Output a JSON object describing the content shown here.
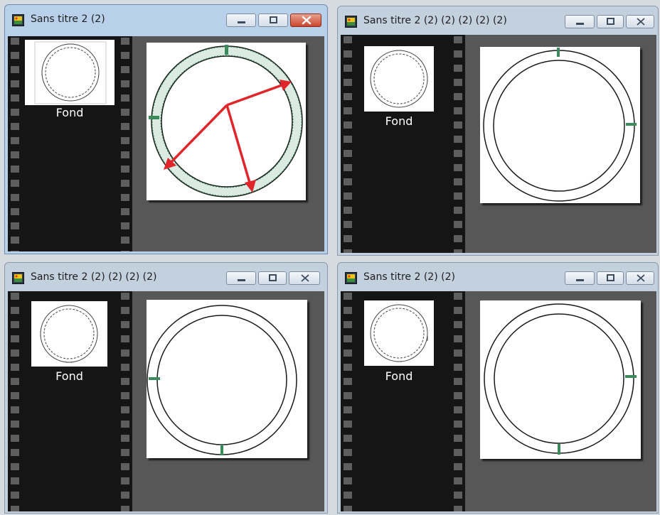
{
  "colors": {
    "titlebar_active": "#b9d0ea",
    "titlebar_inactive": "#c3d0de",
    "workspace": "#575757",
    "film_strip": "#151515",
    "marker": "#3a8a5c",
    "arrow": "#e0262b"
  },
  "windows": [
    {
      "title": "Sans titre 2 (2)",
      "active": true,
      "layer_label": "Fond",
      "icons": [
        "image-icon",
        "minimize-icon",
        "maximize-icon",
        "close-icon"
      ]
    },
    {
      "title": "Sans titre 2 (2) (2) (2) (2) (2)",
      "active": false,
      "layer_label": "Fond",
      "icons": [
        "image-icon",
        "minimize-icon",
        "maximize-icon",
        "close-icon"
      ]
    },
    {
      "title": "Sans titre 2 (2) (2) (2) (2)",
      "active": false,
      "layer_label": "Fond",
      "icons": [
        "image-icon",
        "minimize-icon",
        "maximize-icon",
        "close-icon"
      ]
    },
    {
      "title": "Sans titre 2 (2) (2)",
      "active": false,
      "layer_label": "Fond",
      "icons": [
        "image-icon",
        "minimize-icon",
        "maximize-icon",
        "close-icon"
      ]
    }
  ]
}
